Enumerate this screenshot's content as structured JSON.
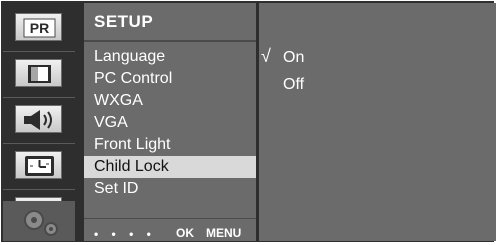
{
  "icons": [
    {
      "name": "pr-icon",
      "label": "PR"
    },
    {
      "name": "picture-icon"
    },
    {
      "name": "sound-icon"
    },
    {
      "name": "timer-icon"
    },
    {
      "name": "input-icon",
      "label": "1"
    },
    {
      "name": "setup-gear-icon"
    }
  ],
  "menu": {
    "title": "SETUP",
    "items": [
      "Language",
      "PC Control",
      "WXGA",
      "VGA",
      "Front Light",
      "Child Lock",
      "Set ID"
    ],
    "selected_index": 5
  },
  "footer": {
    "dots": "• • • •",
    "ok": "OK",
    "menu": "MENU"
  },
  "submenu": {
    "check": "√",
    "options": [
      "On",
      "Off"
    ],
    "checked": "On"
  }
}
